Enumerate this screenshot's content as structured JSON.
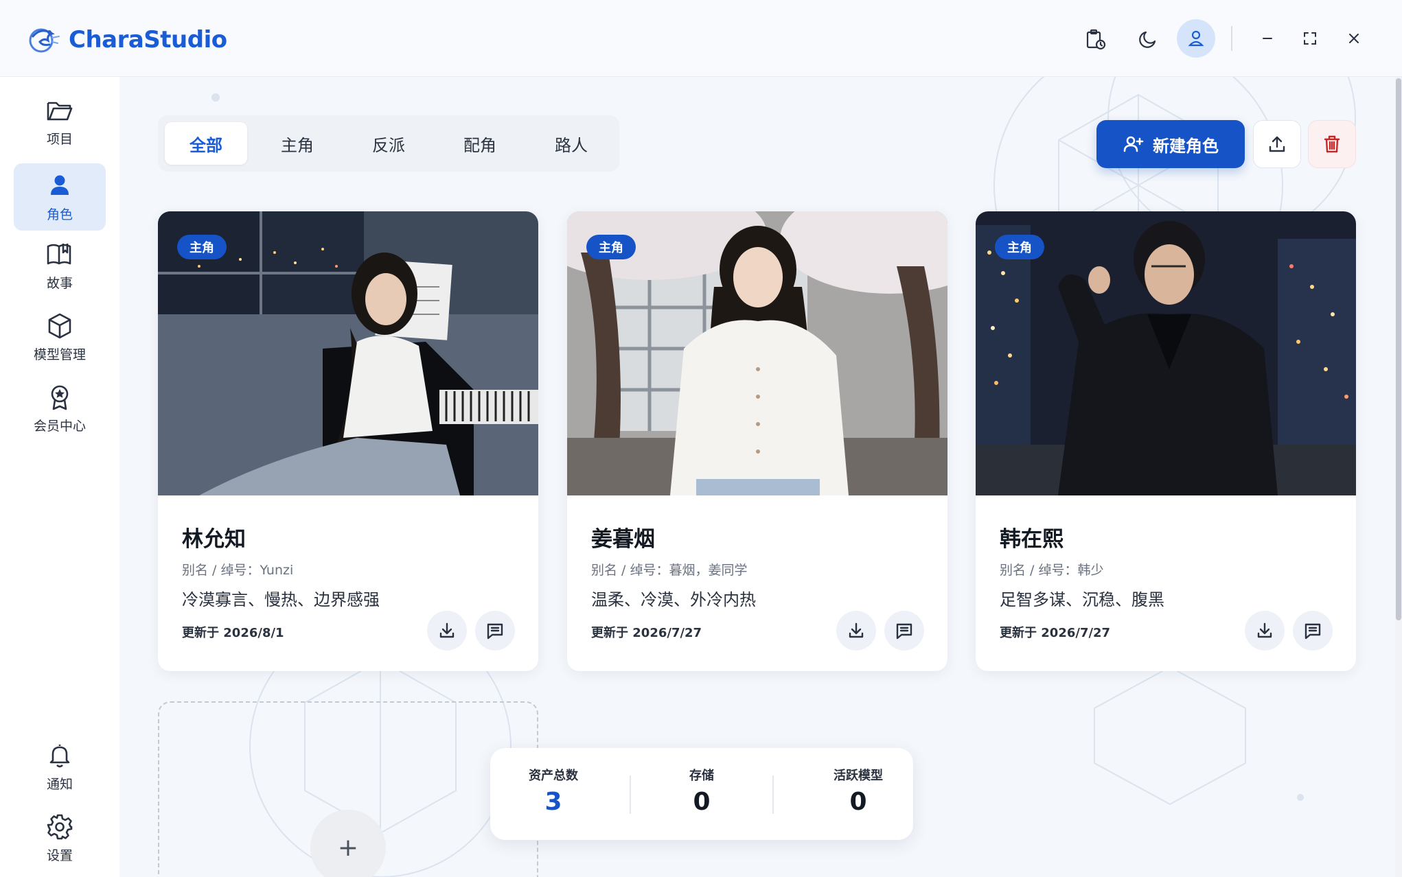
{
  "app": {
    "name": "CharaStudio"
  },
  "titlebar": {
    "icons": [
      "clipboard-clock-icon",
      "moon-icon",
      "user-icon"
    ],
    "window_controls": [
      "minimize-icon",
      "maximize-icon",
      "close-icon"
    ]
  },
  "sidebar": {
    "items": [
      {
        "label": "项目",
        "icon": "folder-icon"
      },
      {
        "label": "角色",
        "icon": "person-icon",
        "active": true
      },
      {
        "label": "故事",
        "icon": "book-icon"
      },
      {
        "label": "模型管理",
        "icon": "cube-icon"
      },
      {
        "label": "会员中心",
        "icon": "badge-icon"
      }
    ],
    "bottom_items": [
      {
        "label": "通知",
        "icon": "bell-icon"
      },
      {
        "label": "设置",
        "icon": "gear-icon"
      }
    ]
  },
  "tabs": [
    "全部",
    "主角",
    "反派",
    "配角",
    "路人"
  ],
  "active_tab": "全部",
  "toolbar": {
    "new_label": "新建角色",
    "accent": "#1553c7"
  },
  "cards": [
    {
      "badge": "主角",
      "name": "林允知",
      "alias": "别名 / 绰号：Yunzi",
      "traits": "冷漠寡言、慢热、边界感强",
      "updated": "更新于 2026/8/1"
    },
    {
      "badge": "主角",
      "name": "姜暮烟",
      "alias": "别名 / 绰号：暮烟，姜同学",
      "traits": "温柔、冷漠、外冷内热",
      "updated": "更新于 2026/7/27"
    },
    {
      "badge": "主角",
      "name": "韩在熙",
      "alias": "别名 / 绰号：韩少",
      "traits": "足智多谋、沉稳、腹黑",
      "updated": "更新于 2026/7/27"
    }
  ],
  "add_card": {
    "symbol": "+"
  },
  "stats": [
    {
      "label": "资产总数",
      "value": "3"
    },
    {
      "label": "存储",
      "value": "0"
    },
    {
      "label": "活跃模型",
      "value": "0"
    }
  ]
}
